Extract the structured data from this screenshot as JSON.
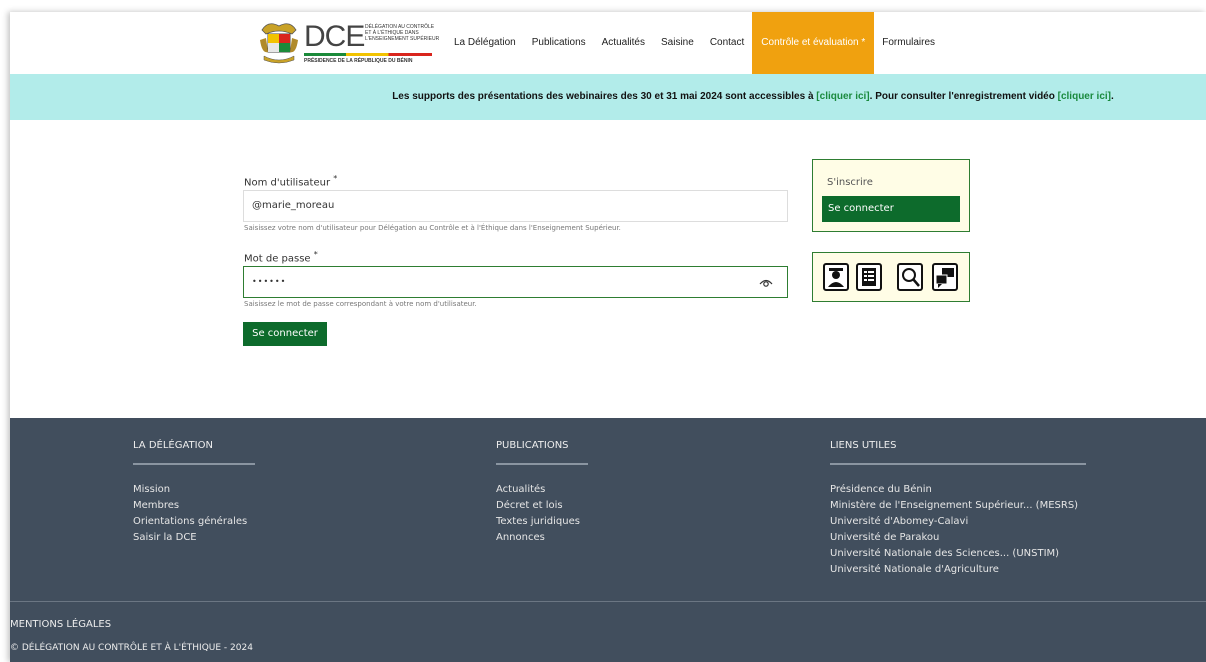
{
  "header": {
    "logo_text": "DCE",
    "logo_tagline": "Délégation au contrôle et à l'éthique dans l'enseignement supérieur",
    "logo_presidency": "PRÉSIDENCE DE LA RÉPUBLIQUE DU BÉNIN",
    "nav": [
      {
        "label": "La Délégation"
      },
      {
        "label": "Publications"
      },
      {
        "label": "Actualités"
      },
      {
        "label": "Saisine"
      },
      {
        "label": "Contact"
      },
      {
        "label": "Contrôle et évaluation *",
        "active": true
      },
      {
        "label": "Formulaires"
      }
    ],
    "active_color": "#f0a10f"
  },
  "banner": {
    "text_before": "Les supports des présentations des webinaires des 30 et 31 mai 2024 sont accessibles à ",
    "link1": "[cliquer ici]",
    "text_middle": ". Pour consulter l'enregistrement vidéo ",
    "link2": "[cliquer ici]",
    "text_after": ".",
    "background": "#b2ecea"
  },
  "form": {
    "username_label": "Nom d'utilisateur",
    "username_value": "@marie_moreau",
    "username_hint": "Saisissez votre nom d'utilisateur pour Délégation au Contrôle et à l'Éthique dans l'Enseignement Supérieur.",
    "password_label": "Mot de passe",
    "password_value": "••••••",
    "password_hint": "Saisissez le mot de passe correspondant à votre nom d'utilisateur.",
    "required_mark": "*",
    "submit_label": "Se connecter"
  },
  "sidebar": {
    "register_label": "S'inscrire",
    "login_label": "Se connecter",
    "tools": [
      "graduate-icon",
      "form-checklist-icon",
      "search-document-icon",
      "chat-bubbles-icon"
    ]
  },
  "footer": {
    "col1": {
      "title": "LA DÉLÉGATION",
      "items": [
        "Mission",
        "Membres",
        "Orientations générales",
        "Saisir la DCE"
      ]
    },
    "col2": {
      "title": "PUBLICATIONS",
      "items": [
        "Actualités",
        "Décret et lois",
        "Textes juridiques",
        "Annonces"
      ]
    },
    "col3": {
      "title": "LIENS UTILES",
      "items": [
        "Présidence du Bénin",
        "Ministère de l'Enseignement Supérieur... (MESRS)",
        "Université d'Abomey-Calavi",
        "Université de Parakou",
        "Université Nationale des Sciences... (UNSTIM)",
        "Université Nationale d'Agriculture"
      ]
    },
    "legal": "MENTIONS LÉGALES",
    "copyright": "© DÉLÉGATION AU CONTRÔLE ET À L'ÉTHIQUE - 2024",
    "background": "#414e5d"
  }
}
